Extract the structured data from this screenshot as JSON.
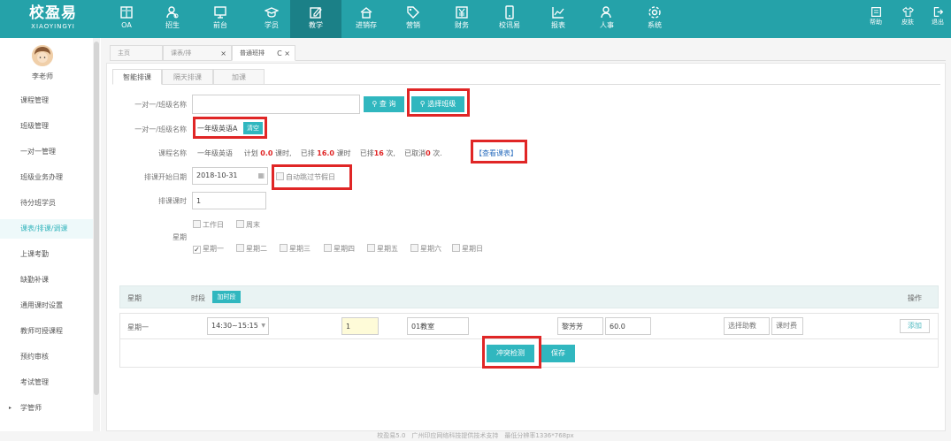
{
  "brand": {
    "name": "校盈易",
    "sub": "XIAOYINGYI"
  },
  "colors": {
    "accent": "#25a2a9",
    "accent_dark": "#1b8087",
    "button": "#30b7bf",
    "highlight": "#e02626"
  },
  "topnav": [
    {
      "label": "OA",
      "icon": "oa-icon"
    },
    {
      "label": "招生",
      "icon": "recruit-icon"
    },
    {
      "label": "前台",
      "icon": "monitor-icon"
    },
    {
      "label": "学员",
      "icon": "graduation-cap-icon"
    },
    {
      "label": "教学",
      "icon": "edit-board-icon",
      "active": true
    },
    {
      "label": "进销存",
      "icon": "house-icon"
    },
    {
      "label": "营销",
      "icon": "tag-icon"
    },
    {
      "label": "财务",
      "icon": "yen-icon"
    },
    {
      "label": "校讯易",
      "icon": "phone-icon"
    },
    {
      "label": "报表",
      "icon": "chart-icon"
    },
    {
      "label": "人事",
      "icon": "people-icon"
    },
    {
      "label": "系统",
      "icon": "gear-icon"
    }
  ],
  "rightnav": [
    {
      "label": "帮助",
      "icon": "help-icon"
    },
    {
      "label": "皮肤",
      "icon": "shirt-icon"
    },
    {
      "label": "退出",
      "icon": "logout-icon"
    }
  ],
  "user": {
    "name": "李老师"
  },
  "sidebar": {
    "items": [
      {
        "label": "课程管理"
      },
      {
        "label": "班级管理"
      },
      {
        "label": "一对一管理"
      },
      {
        "label": "班级业务办理"
      },
      {
        "label": "待分班学员"
      },
      {
        "label": "课表/排课/调课",
        "active": true
      },
      {
        "label": "上课考勤"
      },
      {
        "label": "缺勤补课"
      },
      {
        "label": "通用课时设置"
      },
      {
        "label": "教师可授课程"
      },
      {
        "label": "预约审核"
      },
      {
        "label": "考试管理"
      },
      {
        "label": "学管师"
      }
    ]
  },
  "tabs": [
    {
      "label": "主页"
    },
    {
      "label": "课表/排",
      "close": "×"
    },
    {
      "label": "普通班排",
      "close": "C ×",
      "active": true
    }
  ],
  "subtabs": [
    {
      "label": "智能排课",
      "active": true
    },
    {
      "label": "隔天排课"
    },
    {
      "label": "加课"
    }
  ],
  "form": {
    "class_name_label": "一对一/班级名称",
    "class_name_value": "",
    "query_button": "查 询",
    "select_class_button": "选择班级",
    "selected_label": "一对一/班级名称",
    "selected_value": "一年级英语A",
    "clear_button": "清空",
    "course_label": "课程名称",
    "course_value": "一年级英语",
    "plan_prefix": "计划",
    "plan_value": "0.0",
    "plan_unit": "课时,",
    "scheduled_prefix": "已排",
    "scheduled_value": "16.0",
    "scheduled_unit": "课时",
    "scheduled_count_prefix": "已排",
    "scheduled_count": "16",
    "scheduled_count_unit": "次,",
    "cancelled_prefix": "已取消",
    "cancelled_count": "0",
    "cancelled_unit": "次.",
    "view_schedule_link": "【查看课表】",
    "start_date_label": "排课开始日期",
    "start_date_value": "2018-10-31",
    "skip_holiday_label": "自动跳过节假日",
    "lesson_hours_label": "排课课时",
    "lesson_hours_value": "1",
    "week_label": "星期",
    "weekday_option": "工作日",
    "weekend_option": "周末",
    "days": [
      {
        "label": "星期一",
        "checked": true
      },
      {
        "label": "星期二",
        "checked": false
      },
      {
        "label": "星期三",
        "checked": false
      },
      {
        "label": "星期四",
        "checked": false
      },
      {
        "label": "星期五",
        "checked": false
      },
      {
        "label": "星期六",
        "checked": false
      },
      {
        "label": "星期日",
        "checked": false
      }
    ]
  },
  "table": {
    "col_week": "星期",
    "col_period": "时段",
    "add_period_button": "加时段",
    "col_action": "操作",
    "row": {
      "day": "星期一",
      "time": "14:30~15:15",
      "hours": "1",
      "room": "01教室",
      "teacher": "黎芳芳",
      "rate": "60.0",
      "assistant": "选择助教",
      "fee": "课时费",
      "add": "添加"
    },
    "conflict_button": "冲突检测",
    "save_button": "保存"
  },
  "footer": "校盈易5.0　广州印应网络科技提供技术支持　最低分辨率1336*768px"
}
